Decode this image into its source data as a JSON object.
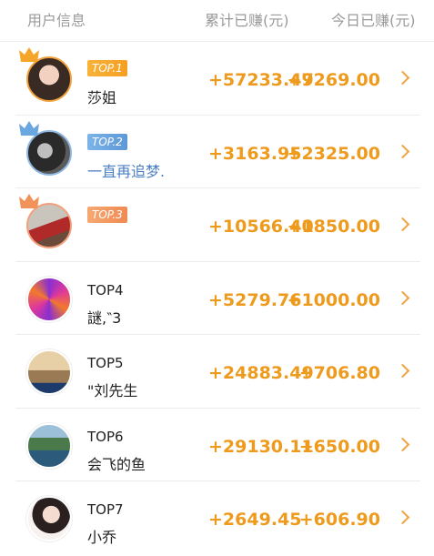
{
  "header": {
    "user_info": "用户信息",
    "total_earned": "累计已赚(元)",
    "today_earned": "今日已赚(元)"
  },
  "rows": [
    {
      "rank": "TOP.1",
      "name": "莎姐",
      "total": "+57233.49",
      "today": "+7269.00"
    },
    {
      "rank": "TOP.2",
      "name": "一直再追梦.",
      "total": "+3163.95",
      "today": "+2325.00"
    },
    {
      "rank": "TOP.3",
      "name": "",
      "total": "+10566.40",
      "today": "+1850.00"
    },
    {
      "rank": "TOP4",
      "name": "謎,‶3",
      "total": "+5279.76",
      "today": "+1000.00"
    },
    {
      "rank": "TOP5",
      "name": "\"刘先生",
      "total": "+24883.49",
      "today": "+706.80"
    },
    {
      "rank": "TOP6",
      "name": "会飞的鱼",
      "total": "+29130.11",
      "today": "+650.00"
    },
    {
      "rank": "TOP7",
      "name": "小乔",
      "total": "+2649.45",
      "today": "+606.90"
    }
  ],
  "icons": {
    "crown": "crown-icon",
    "chevron": "chevron-right-icon"
  },
  "colors": {
    "accent": "#ee9a1c",
    "gold_tag": "#f5a62a",
    "silver_tag": "#6aa6e0",
    "bronze_tag": "#f0925a",
    "name_blue": "#4a7fc1"
  }
}
